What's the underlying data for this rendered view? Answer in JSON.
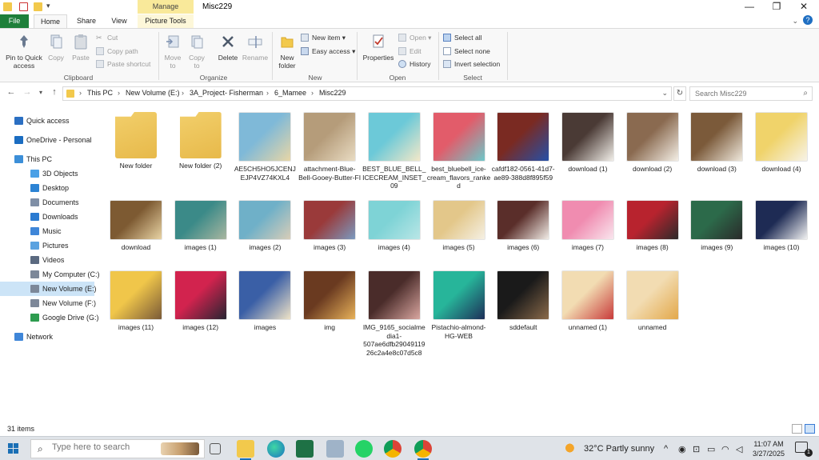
{
  "window": {
    "title": "Misc229",
    "manage_label": "Manage",
    "controls": {
      "minimize": "—",
      "maximize": "❐",
      "close": "✕"
    }
  },
  "tabs": {
    "file": "File",
    "home": "Home",
    "share": "Share",
    "view": "View",
    "picture_tools": "Picture Tools"
  },
  "ribbon": {
    "clipboard": {
      "pin": "Pin to Quick access",
      "copy": "Copy",
      "paste": "Paste",
      "cut": "Cut",
      "copy_path": "Copy path",
      "paste_shortcut": "Paste shortcut",
      "label": "Clipboard"
    },
    "organize": {
      "move_to": "Move to",
      "copy_to": "Copy to",
      "delete": "Delete",
      "rename": "Rename",
      "label": "Organize"
    },
    "new": {
      "new_folder": "New folder",
      "new_item": "New item",
      "easy_access": "Easy access",
      "label": "New"
    },
    "open": {
      "properties": "Properties",
      "open": "Open",
      "edit": "Edit",
      "history": "History",
      "label": "Open"
    },
    "select": {
      "select_all": "Select all",
      "select_none": "Select none",
      "invert": "Invert selection",
      "label": "Select"
    }
  },
  "address": {
    "crumbs": [
      "This PC",
      "New Volume (E:)",
      "3A_Project- Fisherman",
      "6_Mamee",
      "Misc229"
    ],
    "search_placeholder": "Search Misc229"
  },
  "nav": [
    {
      "label": "Quick access",
      "icon": "star-icon",
      "color": "#2b6fc2"
    },
    {
      "label": "OneDrive - Personal",
      "icon": "cloud-icon",
      "color": "#1b6dc1"
    },
    {
      "label": "This PC",
      "icon": "computer-icon",
      "color": "#3c8fd8"
    },
    {
      "label": "3D Objects",
      "icon": "cube-icon",
      "color": "#4aa0e6"
    },
    {
      "label": "Desktop",
      "icon": "desktop-icon",
      "color": "#2c83d4"
    },
    {
      "label": "Documents",
      "icon": "documents-icon",
      "color": "#7f8fa6"
    },
    {
      "label": "Downloads",
      "icon": "download-icon",
      "color": "#2b7bd1"
    },
    {
      "label": "Music",
      "icon": "music-icon",
      "color": "#3f86d8"
    },
    {
      "label": "Pictures",
      "icon": "pictures-icon",
      "color": "#5aa2e0"
    },
    {
      "label": "Videos",
      "icon": "videos-icon",
      "color": "#5b6a80"
    },
    {
      "label": "My Computer (C:)",
      "icon": "drive-icon",
      "color": "#7d8899"
    },
    {
      "label": "New Volume (E:)",
      "icon": "drive-icon",
      "color": "#7d8899"
    },
    {
      "label": "New Volume (F:)",
      "icon": "drive-icon",
      "color": "#7d8899"
    },
    {
      "label": "Google Drive (G:)",
      "icon": "google-drive-icon",
      "color": "#2e9c4f"
    },
    {
      "label": "Network",
      "icon": "network-icon",
      "color": "#3f86d8"
    }
  ],
  "files": [
    {
      "name": "New folder",
      "kind": "folder",
      "c1": "#f2cf6b",
      "c2": "#e7b94a"
    },
    {
      "name": "New folder (2)",
      "kind": "folder",
      "c1": "#f2cf6b",
      "c2": "#e7b94a"
    },
    {
      "name": "AE5CH5HO5JCENJEJP4VZ74KXL4",
      "kind": "image",
      "c1": "#7fb9d8",
      "c2": "#e8d6a6"
    },
    {
      "name": "attachment-Blue-Bell-Gooey-Butter-FI",
      "kind": "image",
      "c1": "#b59c7a",
      "c2": "#e9dcc3"
    },
    {
      "name": "BEST_BLUE_BELL_ICECREAM_INSET_09",
      "kind": "image",
      "c1": "#6cc9d8",
      "c2": "#f3e8c8"
    },
    {
      "name": "best_bluebell_ice-cream_flavors_ranked",
      "kind": "image",
      "c1": "#e25c6a",
      "c2": "#6ec7c9"
    },
    {
      "name": "cafdf182-0561-41d7-ae89-388d8f895f59",
      "kind": "image",
      "c1": "#7a2a22",
      "c2": "#2550a8"
    },
    {
      "name": "download (1)",
      "kind": "image",
      "c1": "#4a3a35",
      "c2": "#f2efe9"
    },
    {
      "name": "download (2)",
      "kind": "image",
      "c1": "#8a6a50",
      "c2": "#f4efe6"
    },
    {
      "name": "download (3)",
      "kind": "image",
      "c1": "#7b5a3a",
      "c2": "#efe8dc"
    },
    {
      "name": "download (4)",
      "kind": "image",
      "c1": "#f0d36a",
      "c2": "#f7f3e8"
    },
    {
      "name": "download",
      "kind": "image",
      "c1": "#7d5a32",
      "c2": "#e8d3a4"
    },
    {
      "name": "images (1)",
      "kind": "image",
      "c1": "#3b8a88",
      "c2": "#a9b6a0"
    },
    {
      "name": "images (2)",
      "kind": "image",
      "c1": "#6fb0c8",
      "c2": "#d8cdb8"
    },
    {
      "name": "images (3)",
      "kind": "image",
      "c1": "#9a3a3a",
      "c2": "#7a9ac0"
    },
    {
      "name": "images (4)",
      "kind": "image",
      "c1": "#7ed3d6",
      "c2": "#b9e6e6"
    },
    {
      "name": "images (5)",
      "kind": "image",
      "c1": "#e3c78a",
      "c2": "#f5f0e4"
    },
    {
      "name": "images (6)",
      "kind": "image",
      "c1": "#5a2e2a",
      "c2": "#f1ece6"
    },
    {
      "name": "images (7)",
      "kind": "image",
      "c1": "#f08cb0",
      "c2": "#f9e6ee"
    },
    {
      "name": "images (8)",
      "kind": "image",
      "c1": "#b8232e",
      "c2": "#2c2a2a"
    },
    {
      "name": "images (9)",
      "kind": "image",
      "c1": "#2c6a4a",
      "c2": "#2a2a2a"
    },
    {
      "name": "images (10)",
      "kind": "image",
      "c1": "#1e2b54",
      "c2": "#f2f2f2"
    },
    {
      "name": "images (11)",
      "kind": "image",
      "c1": "#f0c64a",
      "c2": "#7a5a38"
    },
    {
      "name": "images (12)",
      "kind": "image",
      "c1": "#d2234e",
      "c2": "#262432"
    },
    {
      "name": "images",
      "kind": "image",
      "c1": "#3a5fa6",
      "c2": "#efe3c7"
    },
    {
      "name": "img",
      "kind": "image",
      "c1": "#6a3a20",
      "c2": "#e8b25a"
    },
    {
      "name": "IMG_9165_socialmedia1-507ae6dfb2904911926c2a4e8c07d5c8",
      "kind": "image",
      "c1": "#4a2c2a",
      "c2": "#d9a6a0"
    },
    {
      "name": "Pistachio-almond-HG-WEB",
      "kind": "image",
      "c1": "#27b59a",
      "c2": "#1d2e58"
    },
    {
      "name": "sddefault",
      "kind": "image",
      "c1": "#1a1a1a",
      "c2": "#8a6a4a"
    },
    {
      "name": "unnamed (1)",
      "kind": "image",
      "c1": "#f2dcb2",
      "c2": "#c83a3a"
    },
    {
      "name": "unnamed",
      "kind": "image",
      "c1": "#f2dcb2",
      "c2": "#e3a84a"
    }
  ],
  "status": {
    "count": "31 items"
  },
  "taskbar": {
    "search_placeholder": "Type here to search",
    "weather": "32°C  Partly sunny",
    "time": "11:07 AM",
    "date": "3/27/2025",
    "notification_count": "1"
  }
}
